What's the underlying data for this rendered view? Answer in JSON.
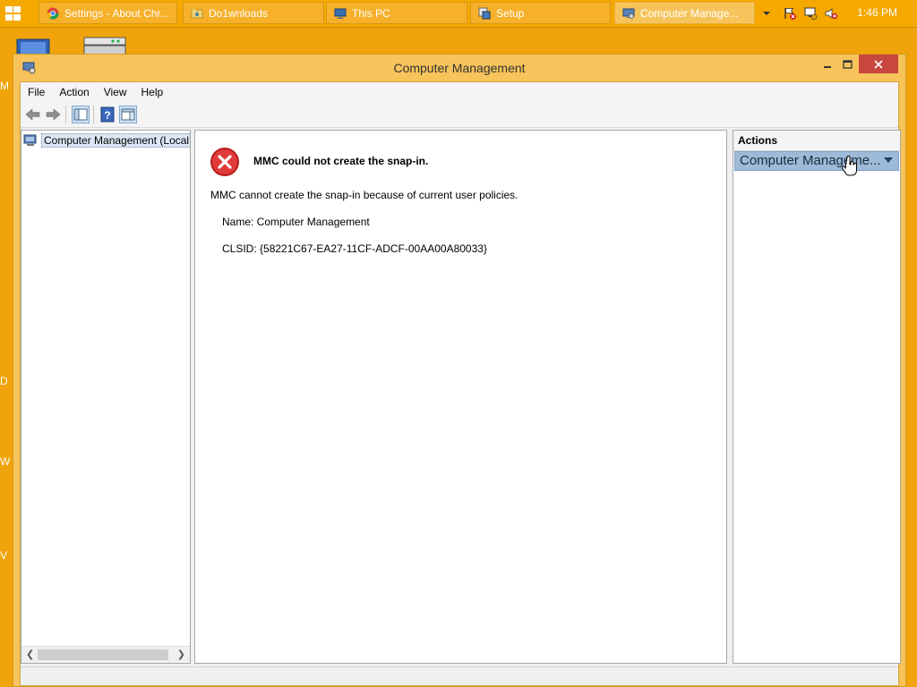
{
  "taskbar": {
    "buttons": [
      {
        "label": "Settings - About Chr...",
        "icon": "chrome-icon"
      },
      {
        "label": "Do1wnloads",
        "icon": "folder-icon"
      },
      {
        "label": "This PC",
        "icon": "computer-icon"
      },
      {
        "label": "Setup",
        "icon": "setup-icon"
      },
      {
        "label": "Computer Manage...",
        "icon": "computer-management-icon"
      }
    ],
    "clock": "1:46 PM",
    "tray_icons": [
      "overflow-chevron-icon",
      "action-center-flag-icon",
      "network-icon",
      "volume-muted-icon"
    ]
  },
  "desktop": {
    "edge_letters": [
      "M",
      "D",
      "W",
      "V"
    ]
  },
  "window": {
    "title": "Computer Management",
    "menu": [
      "File",
      "Action",
      "View",
      "Help"
    ],
    "toolbar": [
      "back-arrow-icon",
      "forward-arrow-icon",
      "show-hide-tree-icon",
      "help-icon",
      "show-hide-action-pane-icon"
    ]
  },
  "tree": {
    "root_label": "Computer Management (Local"
  },
  "error": {
    "title": "MMC could not create the snap-in.",
    "message": "MMC cannot create the snap-in because of current user policies.",
    "name": "Name: Computer Management",
    "clsid": "CLSID: {58221C67-EA27-11CF-ADCF-00AA00A80033}"
  },
  "actions": {
    "header": "Actions",
    "item": "Computer Manageme..."
  },
  "colors": {
    "desktop": "#f0a30a",
    "taskbar": "#f5a800",
    "window_frame": "#f7c35a",
    "close_button": "#c7463e",
    "selection": "#9dbad8"
  }
}
